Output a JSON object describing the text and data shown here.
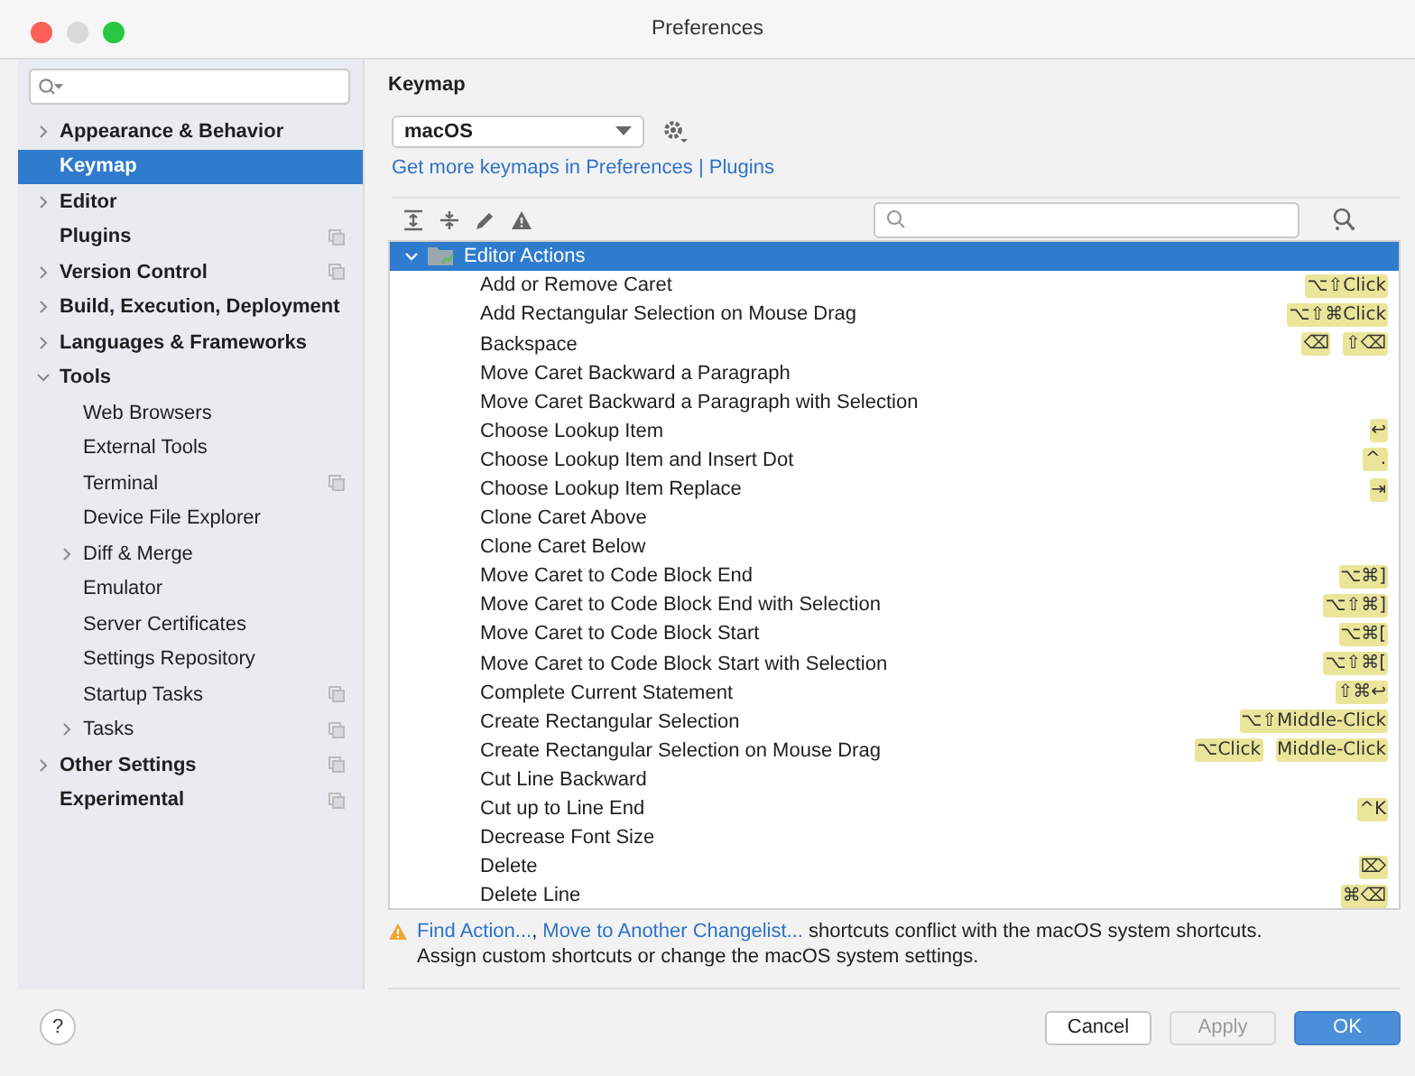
{
  "window": {
    "title": "Preferences"
  },
  "sidebar": {
    "items": [
      {
        "label": "Appearance & Behavior",
        "expanded": false,
        "selected": false,
        "project_icon": false
      },
      {
        "label": "Keymap",
        "selected": true,
        "project_icon": false
      },
      {
        "label": "Editor",
        "expanded": false,
        "selected": false,
        "project_icon": false
      },
      {
        "label": "Plugins",
        "selected": false,
        "project_icon": true
      },
      {
        "label": "Version Control",
        "expanded": false,
        "selected": false,
        "project_icon": true
      },
      {
        "label": "Build, Execution, Deployment",
        "expanded": false,
        "selected": false,
        "project_icon": false
      },
      {
        "label": "Languages & Frameworks",
        "expanded": false,
        "selected": false,
        "project_icon": false
      },
      {
        "label": "Tools",
        "expanded": true,
        "selected": false,
        "project_icon": false,
        "children": [
          {
            "label": "Web Browsers",
            "selected": false,
            "project_icon": false
          },
          {
            "label": "External Tools",
            "selected": false,
            "project_icon": false
          },
          {
            "label": "Terminal",
            "selected": false,
            "project_icon": true
          },
          {
            "label": "Device File Explorer",
            "selected": false,
            "project_icon": false
          },
          {
            "label": "Diff & Merge",
            "expanded": false,
            "selected": false,
            "project_icon": false
          },
          {
            "label": "Emulator",
            "selected": false,
            "project_icon": false
          },
          {
            "label": "Server Certificates",
            "selected": false,
            "project_icon": false
          },
          {
            "label": "Settings Repository",
            "selected": false,
            "project_icon": false
          },
          {
            "label": "Startup Tasks",
            "selected": false,
            "project_icon": true
          },
          {
            "label": "Tasks",
            "expanded": false,
            "selected": false,
            "project_icon": true
          }
        ]
      },
      {
        "label": "Other Settings",
        "expanded": false,
        "selected": false,
        "project_icon": true
      },
      {
        "label": "Experimental",
        "selected": false,
        "project_icon": true
      }
    ]
  },
  "content": {
    "title": "Keymap",
    "keymap_select": "macOS",
    "link_prefix": "Get more keymaps in Preferences | ",
    "link": "Plugins",
    "tree": {
      "label": "Editor Actions",
      "expanded": true,
      "selected": true,
      "actions": [
        {
          "label": "Add or Remove Caret",
          "shortcuts": [
            "⌥⇧Click"
          ]
        },
        {
          "label": "Add Rectangular Selection on Mouse Drag",
          "shortcuts": [
            "⌥⇧⌘Click"
          ]
        },
        {
          "label": "Backspace",
          "shortcuts": [
            "⌫",
            "⇧⌫"
          ]
        },
        {
          "label": "Move Caret Backward a Paragraph"
        },
        {
          "label": "Move Caret Backward a Paragraph with Selection"
        },
        {
          "label": "Choose Lookup Item",
          "shortcuts": [
            "↩"
          ]
        },
        {
          "label": "Choose Lookup Item and Insert Dot",
          "shortcuts": [
            "^."
          ]
        },
        {
          "label": "Choose Lookup Item Replace",
          "shortcuts": [
            "⇥"
          ]
        },
        {
          "label": "Clone Caret Above"
        },
        {
          "label": "Clone Caret Below"
        },
        {
          "label": "Move Caret to Code Block End",
          "shortcuts": [
            "⌥⌘]"
          ]
        },
        {
          "label": "Move Caret to Code Block End with Selection",
          "shortcuts": [
            "⌥⇧⌘]"
          ]
        },
        {
          "label": "Move Caret to Code Block Start",
          "shortcuts": [
            "⌥⌘["
          ]
        },
        {
          "label": "Move Caret to Code Block Start with Selection",
          "shortcuts": [
            "⌥⇧⌘["
          ]
        },
        {
          "label": "Complete Current Statement",
          "shortcuts": [
            "⇧⌘↩"
          ]
        },
        {
          "label": "Create Rectangular Selection",
          "shortcuts": [
            "⌥⇧Middle-Click"
          ]
        },
        {
          "label": "Create Rectangular Selection on Mouse Drag",
          "shortcuts": [
            "⌥Click",
            "Middle-Click"
          ]
        },
        {
          "label": "Cut Line Backward"
        },
        {
          "label": "Cut up to Line End",
          "shortcuts": [
            "^K"
          ]
        },
        {
          "label": "Decrease Font Size"
        },
        {
          "label": "Delete",
          "shortcuts": [
            "⌦"
          ]
        },
        {
          "label": "Delete Line",
          "shortcuts": [
            "⌘⌫"
          ]
        }
      ]
    },
    "warning": {
      "separator": ",",
      "links": [
        "Find Action...",
        "Move to Another Changelist..."
      ],
      "text": " shortcuts conflict with the macOS system shortcuts.",
      "text2": "Assign custom shortcuts or change the macOS system settings."
    }
  },
  "help_button": "?",
  "buttons": [
    {
      "label": "Cancel",
      "kind": "normal",
      "disabled": false
    },
    {
      "label": "Apply",
      "kind": "normal",
      "disabled": true
    },
    {
      "label": "OK",
      "kind": "default",
      "disabled": false
    }
  ]
}
